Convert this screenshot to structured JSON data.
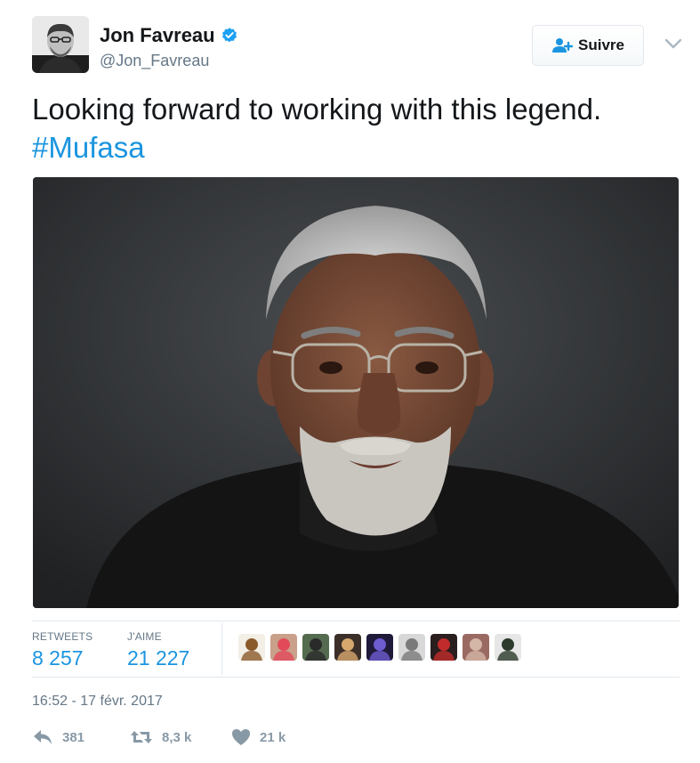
{
  "author": {
    "name": "Jon Favreau",
    "handle": "@Jon_Favreau",
    "verified": true,
    "avatar_icon": "user-avatar-photo"
  },
  "follow_button": {
    "label": "Suivre",
    "icon": "add-user-icon"
  },
  "menu_icon": "chevron-down-icon",
  "tweet": {
    "text": "Looking forward to working with this legend.",
    "hashtag": "#Mufasa",
    "media": "portrait-photo"
  },
  "stats": {
    "retweets_label": "RETWEETS",
    "retweets_value": "8 257",
    "likes_label": "J'AIME",
    "likes_value": "21 227",
    "liker_avatars": [
      {
        "name": "liker-1",
        "bg": "#f3efe6",
        "fg": "#8a5a2b"
      },
      {
        "name": "liker-2",
        "bg": "#c9a08a",
        "fg": "#e24a5a"
      },
      {
        "name": "liker-3",
        "bg": "#556b4f",
        "fg": "#2a2a2a"
      },
      {
        "name": "liker-4",
        "bg": "#3c2f2a",
        "fg": "#d7a86e"
      },
      {
        "name": "liker-5",
        "bg": "#1f1a3a",
        "fg": "#6d5bd0"
      },
      {
        "name": "liker-6",
        "bg": "#d8d8d8",
        "fg": "#7a7a7a"
      },
      {
        "name": "liker-7",
        "bg": "#2a1e1e",
        "fg": "#c22b2b"
      },
      {
        "name": "liker-8",
        "bg": "#9a6a62",
        "fg": "#d4b7a6"
      },
      {
        "name": "liker-9",
        "bg": "#e6e6e6",
        "fg": "#2c3a2c"
      }
    ]
  },
  "timestamp": "16:52 - 17 févr. 2017",
  "actions": {
    "reply_count": "381",
    "retweet_count": "8,3 k",
    "like_count": "21 k"
  },
  "colors": {
    "link": "#1b95e0",
    "muted": "#657786",
    "action_gray": "#8899a6",
    "verified_blue": "#1da1f2"
  }
}
